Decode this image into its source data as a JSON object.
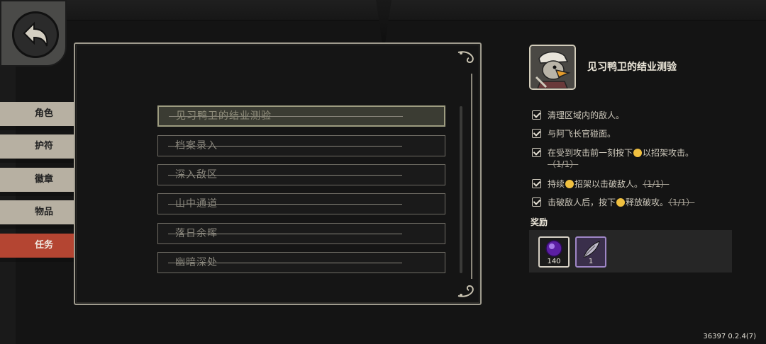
{
  "tabs": [
    {
      "label": "角色",
      "active": false
    },
    {
      "label": "护符",
      "active": false
    },
    {
      "label": "徽章",
      "active": false
    },
    {
      "label": "物品",
      "active": false
    },
    {
      "label": "任务",
      "active": true
    }
  ],
  "quests": [
    {
      "label": "见习鸭卫的结业测验",
      "selected": true
    },
    {
      "label": "档案录入",
      "selected": false
    },
    {
      "label": "深入敌区",
      "selected": false
    },
    {
      "label": "山中通道",
      "selected": false
    },
    {
      "label": "落日余晖",
      "selected": false
    },
    {
      "label": "幽暗深处",
      "selected": false
    }
  ],
  "detail": {
    "title": "见习鸭卫的结业测验",
    "objectives": [
      {
        "parts": [
          "清理区域内的敌人。"
        ]
      },
      {
        "parts": [
          "与阿飞长官碰面。"
        ]
      },
      {
        "parts": [
          "在受到攻击前一刻按下",
          "以招架攻击。",
          "（1/1）"
        ]
      },
      {
        "parts": [
          "持续",
          "招架以击破敌人。",
          "（1/1）"
        ]
      },
      {
        "parts": [
          "击破敌人后，按下",
          "释放破攻。",
          "（1/1）"
        ]
      }
    ],
    "rewards_label": "奖励",
    "rewards": [
      {
        "icon": "purple-orb-icon",
        "count": "140"
      },
      {
        "icon": "feather-icon",
        "count": "1"
      }
    ]
  },
  "version": "36397 0.2.4(7)",
  "colors": {
    "active_tab": "#b44532",
    "tab": "#b7b0a2",
    "panel_border": "#9f9b8e",
    "rare_slot": "#9f86c7"
  }
}
